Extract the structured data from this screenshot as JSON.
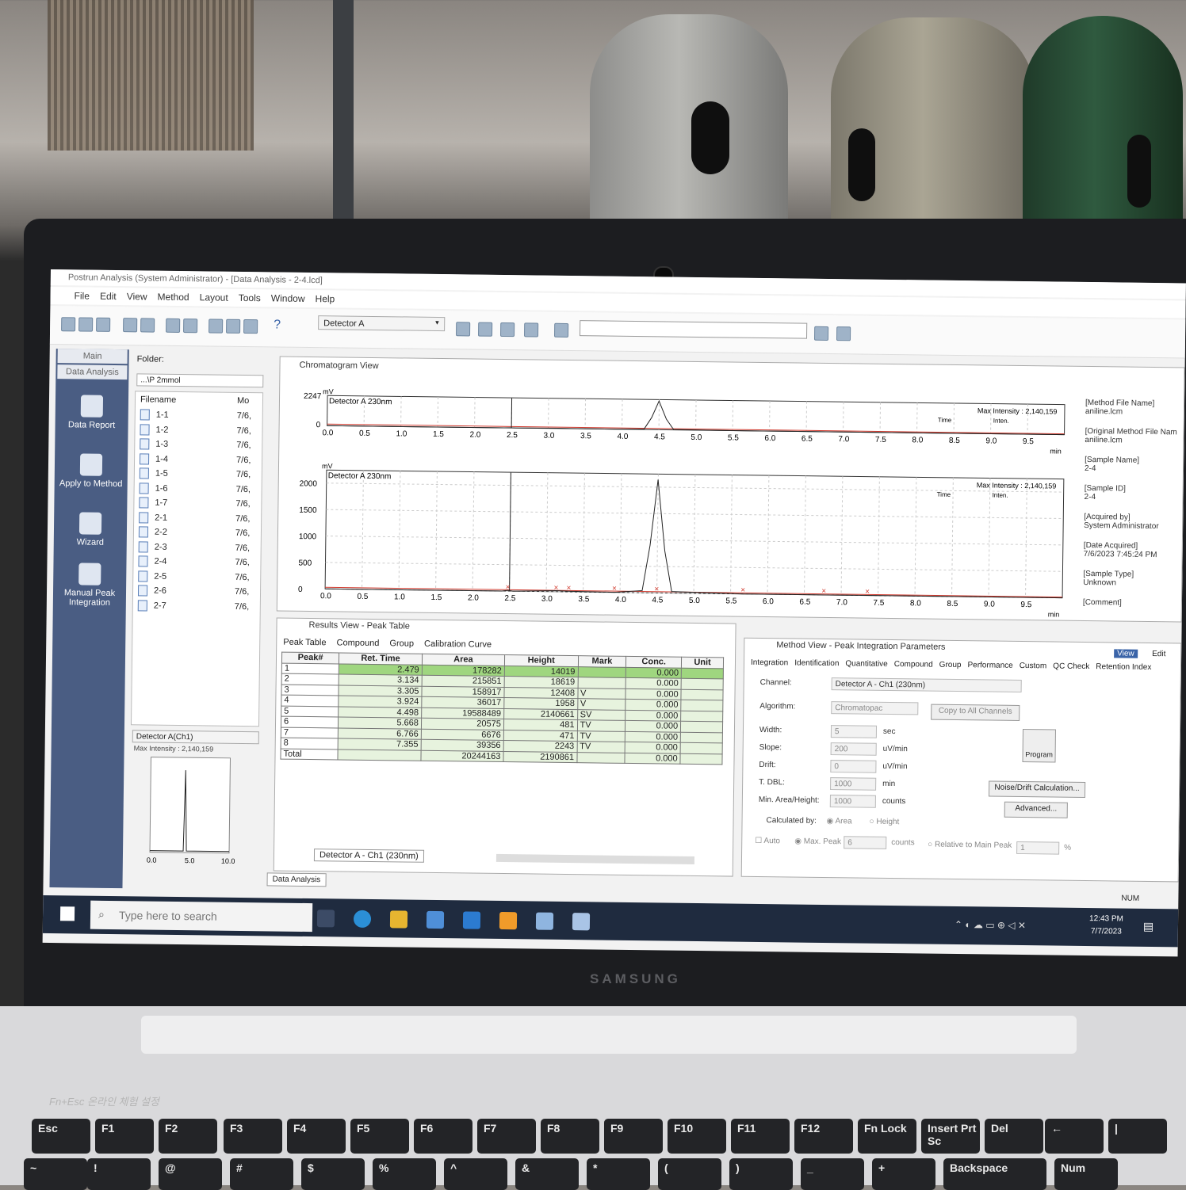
{
  "window": {
    "title": "Postrun Analysis (System Administrator) - [Data Analysis - 2-4.lcd]",
    "menu": [
      "File",
      "Edit",
      "View",
      "Method",
      "Layout",
      "Tools",
      "Window",
      "Help"
    ],
    "detector_select": "Detector A"
  },
  "left_panel": {
    "tabs": [
      "Main",
      "Data Analysis"
    ],
    "items": [
      "Data Report",
      "Apply to Method",
      "Wizard",
      "Manual Peak Integration"
    ]
  },
  "file_panel": {
    "folder_label": "Folder:",
    "folder_value": "...\\P 2mmol",
    "col_filename": "Filename",
    "col_mod": "Mo",
    "files": [
      "1-1",
      "1-2",
      "1-3",
      "1-4",
      "1-5",
      "1-6",
      "1-7",
      "2-1",
      "2-2",
      "2-3",
      "2-4",
      "2-5",
      "2-6",
      "2-7"
    ],
    "date_trunc": "7/6,",
    "detector_select": "Detector A(Ch1)",
    "max_intensity": "Max Intensity : 2,140,159",
    "mini_ticks": [
      "0.0",
      "5.0",
      "10.0"
    ]
  },
  "chromatogram": {
    "title": "Chromatogram View",
    "detector_label": "Detector A 230nm",
    "max_intensity": "Max Intensity : 2,140,159",
    "time_col": "Time",
    "inten_col": "Inten.",
    "unit_mv": "mV",
    "unit_min": "min",
    "top_y_max": "2247",
    "top_y_zero": "0",
    "y_ticks": [
      "0",
      "500",
      "1000",
      "1500",
      "2000"
    ],
    "x_ticks": [
      "0.0",
      "0.5",
      "1.0",
      "1.5",
      "2.0",
      "2.5",
      "3.0",
      "3.5",
      "4.0",
      "4.5",
      "5.0",
      "5.5",
      "6.0",
      "6.5",
      "7.0",
      "7.5",
      "8.0",
      "8.5",
      "9.0",
      "9.5"
    ],
    "info": [
      [
        "[Method File Name]",
        "aniline.lcm"
      ],
      [
        "[Original Method File Nam",
        "aniline.lcm"
      ],
      [
        "[Sample Name]",
        "2-4"
      ],
      [
        "[Sample ID]",
        "2-4"
      ],
      [
        "[Acquired by]",
        "System Administrator"
      ],
      [
        "[Date Acquired]",
        "7/6/2023 7:45:24 PM"
      ],
      [
        "[Sample Type]",
        "Unknown"
      ],
      [
        "[Comment]",
        ""
      ]
    ]
  },
  "chart_data": {
    "type": "line",
    "title": "Detector A 230nm",
    "xlabel": "min",
    "ylabel": "mV",
    "xlim": [
      0,
      10
    ],
    "ylim": [
      0,
      2247
    ],
    "x": [
      0,
      2.4,
      2.479,
      2.55,
      3.134,
      3.305,
      3.924,
      4.3,
      4.4,
      4.498,
      4.6,
      4.7,
      5.668,
      6.766,
      7.355,
      10
    ],
    "series": [
      {
        "values": [
          0,
          0,
          14,
          0,
          19,
          12,
          2,
          40,
          900,
          2140,
          800,
          30,
          0.5,
          0.5,
          2,
          0
        ]
      }
    ]
  },
  "results": {
    "title": "Results View - Peak Table",
    "tabs": [
      "Peak Table",
      "Compound",
      "Group",
      "Calibration Curve"
    ],
    "columns": [
      "Peak#",
      "Ret. Time",
      "Area",
      "Height",
      "Mark",
      "Conc.",
      "Unit"
    ],
    "rows": [
      [
        "1",
        "2.479",
        "178282",
        "14019",
        "",
        "0.000",
        ""
      ],
      [
        "2",
        "3.134",
        "215851",
        "18619",
        "",
        "0.000",
        ""
      ],
      [
        "3",
        "3.305",
        "158917",
        "12408",
        "V",
        "0.000",
        ""
      ],
      [
        "4",
        "3.924",
        "36017",
        "1958",
        "V",
        "0.000",
        ""
      ],
      [
        "5",
        "4.498",
        "19588489",
        "2140661",
        "SV",
        "0.000",
        ""
      ],
      [
        "6",
        "5.668",
        "20575",
        "481",
        "TV",
        "0.000",
        ""
      ],
      [
        "7",
        "6.766",
        "6676",
        "471",
        "TV",
        "0.000",
        ""
      ],
      [
        "8",
        "7.355",
        "39356",
        "2243",
        "TV",
        "0.000",
        ""
      ],
      [
        "Total",
        "",
        "20244163",
        "2190861",
        "",
        "0.000",
        ""
      ]
    ],
    "bottom_tab": "Detector A - Ch1 (230nm)",
    "doc_tab": "Data Analysis"
  },
  "method_view": {
    "title": "Method View - Peak Integration Parameters",
    "view_btn": "View",
    "edit_btn": "Edit",
    "tabs": [
      "Integration",
      "Identification",
      "Quantitative",
      "Compound",
      "Group",
      "Performance",
      "Custom",
      "QC Check",
      "Retention Index"
    ],
    "channel_label": "Channel:",
    "channel_value": "Detector A - Ch1 (230nm)",
    "algorithm_label": "Algorithm:",
    "algorithm_value": "Chromatopac",
    "copy_btn": "Copy to All Channels",
    "width_label": "Width:",
    "width_value": "5",
    "width_unit": "sec",
    "slope_label": "Slope:",
    "slope_value": "200",
    "slope_unit": "uV/min",
    "drift_label": "Drift:",
    "drift_value": "0",
    "drift_unit": "uV/min",
    "tdbl_label": "T. DBL:",
    "tdbl_value": "1000",
    "tdbl_unit": "min",
    "minarea_label": "Min. Area/Height:",
    "minarea_value": "1000",
    "minarea_unit": "counts",
    "program_btn": "Program",
    "noise_btn": "Noise/Drift Calculation...",
    "advanced_btn": "Advanced...",
    "calc_label": "Calculated by:",
    "calc_area": "Area",
    "calc_height": "Height",
    "auto_label": "Auto",
    "maxpeak_label": "Max. Peak",
    "maxpeak_value": "6",
    "maxpeak_unit": "counts",
    "relative_label": "Relative to Main Peak",
    "relative_value": "1",
    "relative_unit": "%"
  },
  "taskbar": {
    "search_placeholder": "Type here to search",
    "time": "12:43 PM",
    "date": "7/7/2023",
    "num": "NUM"
  },
  "laptop": {
    "brand": "SAMSUNG",
    "fn_label": "Fn+Esc 온라인 체험 설정",
    "fkeys": [
      "Esc",
      "F1",
      "F2",
      "F3",
      "F4",
      "F5",
      "F6",
      "F7",
      "F8",
      "F9",
      "F10",
      "F11",
      "F12",
      "Fn Lock",
      "Insert Prt Sc",
      "Del",
      "←",
      "|"
    ],
    "row2": [
      "~",
      "!",
      "@",
      "#",
      "$",
      "%",
      "^",
      "&",
      "*",
      "(",
      ")",
      "_",
      "+",
      "Backspace",
      "Num"
    ]
  }
}
